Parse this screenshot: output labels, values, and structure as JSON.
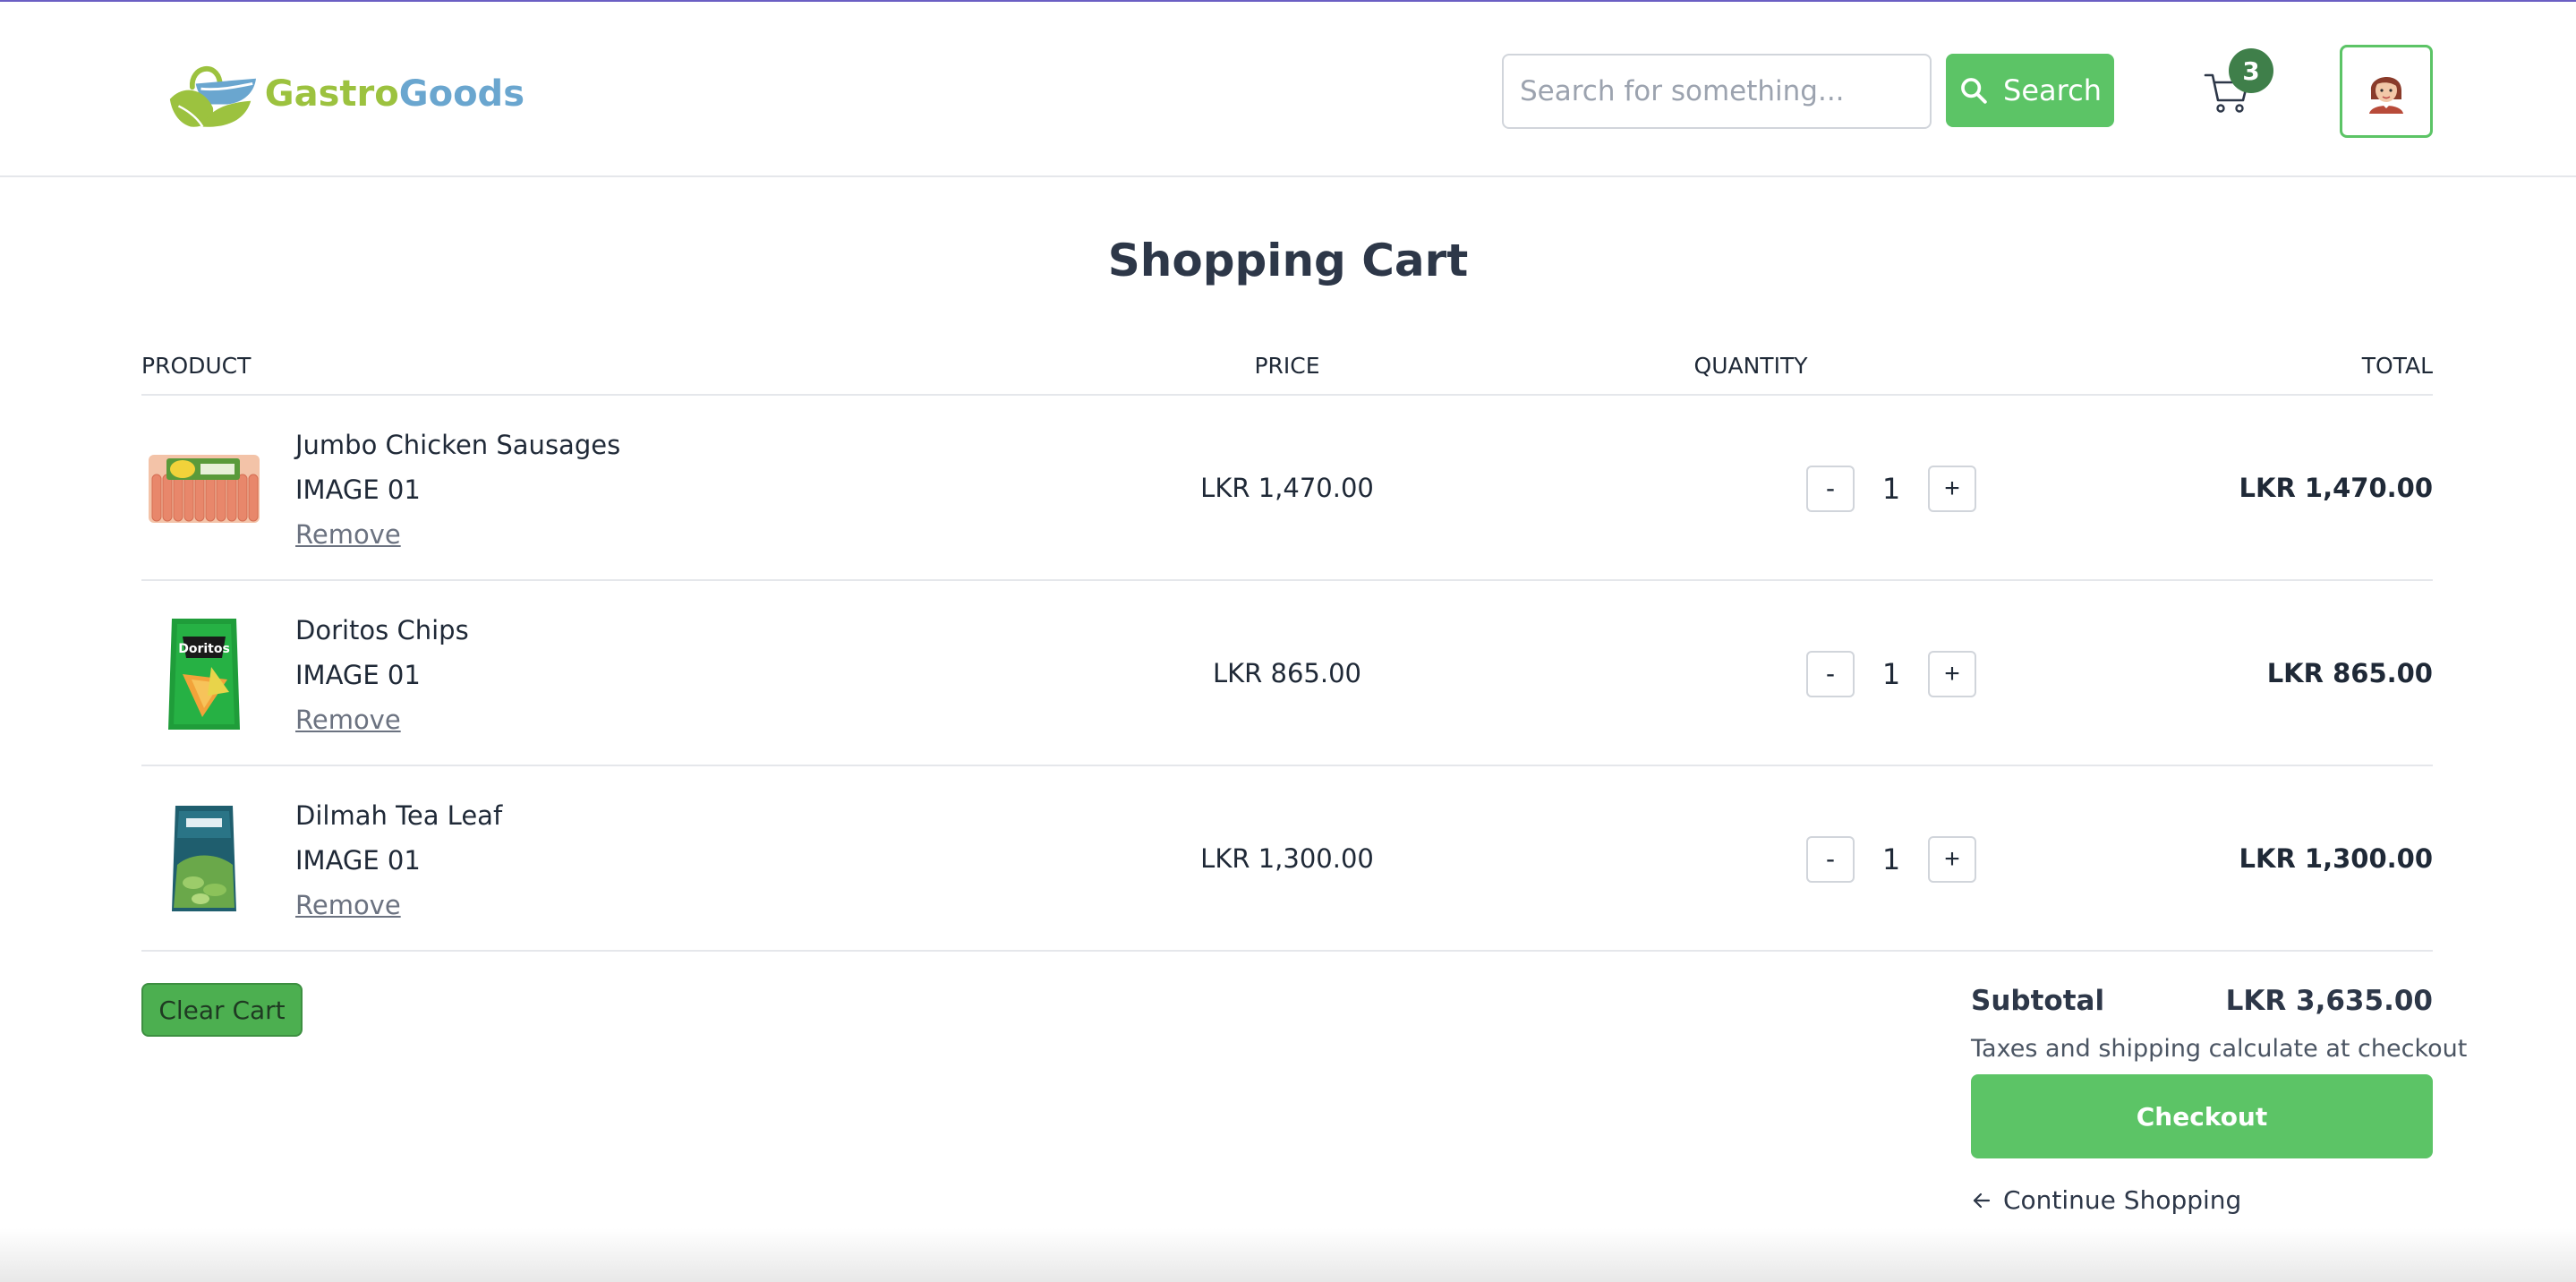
{
  "brand": {
    "part1": "Gastro",
    "part2": "Goods"
  },
  "header": {
    "search_placeholder": "Search for something...",
    "search_label": "Search",
    "cart_count": "3"
  },
  "page": {
    "title": "Shopping Cart"
  },
  "table": {
    "headers": {
      "product": "PRODUCT",
      "price": "PRICE",
      "quantity": "QUANTITY",
      "total": "TOTAL"
    },
    "items": [
      {
        "name": "Jumbo Chicken Sausages",
        "subtitle": "IMAGE 01",
        "remove": "Remove",
        "price": "LKR 1,470.00",
        "quantity": "1",
        "total": "LKR 1,470.00",
        "image": "sausages-image"
      },
      {
        "name": "Doritos Chips",
        "subtitle": "IMAGE 01",
        "remove": "Remove",
        "price": "LKR 865.00",
        "quantity": "1",
        "total": "LKR 865.00",
        "image": "doritos-image"
      },
      {
        "name": "Dilmah Tea Leaf",
        "subtitle": "IMAGE 01",
        "remove": "Remove",
        "price": "LKR 1,300.00",
        "quantity": "1",
        "total": "LKR 1,300.00",
        "image": "tea-image"
      }
    ],
    "minus_label": "-",
    "plus_label": "+"
  },
  "actions": {
    "clear_cart": "Clear Cart"
  },
  "summary": {
    "subtotal_label": "Subtotal",
    "subtotal_value": "LKR 3,635.00",
    "tax_note": "Taxes and shipping calculate at checkout",
    "checkout": "Checkout",
    "continue": "Continue Shopping"
  },
  "colors": {
    "accent": "#5cc466",
    "badge": "#3f7f4a",
    "logo_green": "#9cc23f",
    "logo_blue": "#6aa6cf"
  }
}
